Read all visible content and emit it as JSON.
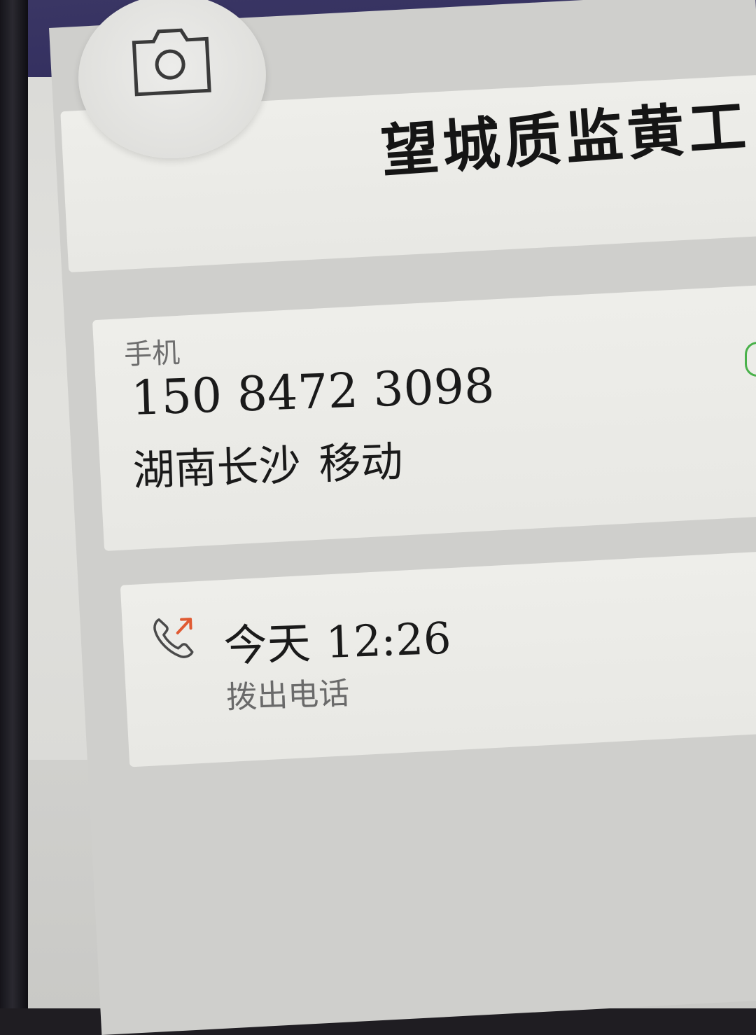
{
  "header": {
    "avatar_icon": "camera-icon",
    "contact_name": "望城质监黄工"
  },
  "number_card": {
    "type_label": "手机",
    "phone_number": "150 8472 3098",
    "region": "湖南长沙",
    "carrier": "移动",
    "side_action_icon": "message-icon",
    "side_action_color": "#49b14a"
  },
  "call_log": {
    "direction_icon": "outgoing-call-icon",
    "direction_color": "#e05a32",
    "day": "今天",
    "time": "12:26",
    "call_type": "拨出电话"
  },
  "theme": {
    "status_bar_color": "#343060",
    "card_color": "#ecece8",
    "background_color": "#d6d6d3"
  }
}
